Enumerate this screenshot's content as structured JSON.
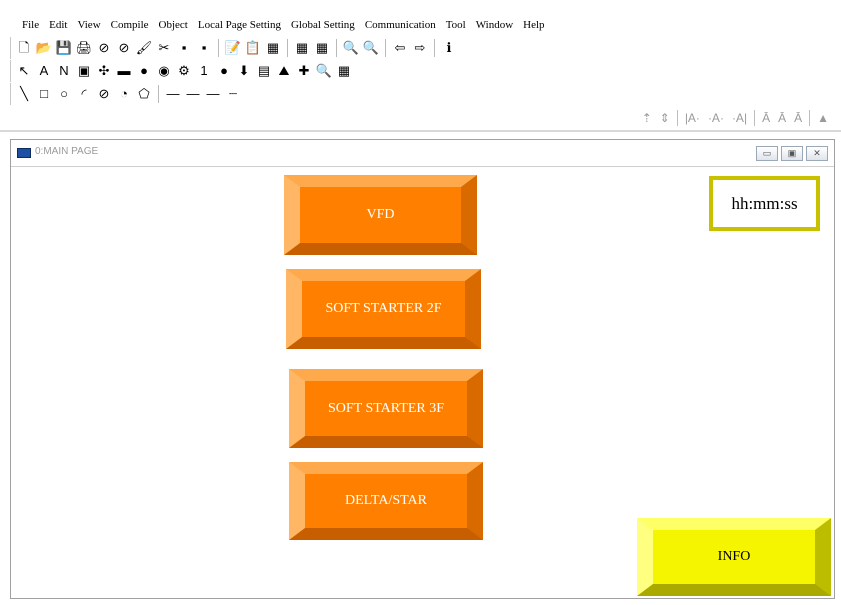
{
  "menu": [
    "File",
    "Edit",
    "View",
    "Compile",
    "Object",
    "Local Page Setting",
    "Global Setting",
    "Communication",
    "Tool",
    "Window",
    "Help"
  ],
  "toolbar1": [
    "🗋",
    "📂",
    "💾",
    "🖨",
    "⊘",
    "⊘",
    "🖌",
    "✂",
    "▪",
    "▪",
    "📝",
    "📋",
    "▦",
    "▦",
    "▦",
    "🔍",
    "🔍",
    "⇦",
    "⇨",
    "ℹ"
  ],
  "toolbar2": [
    "↖",
    "A",
    "N",
    "▣",
    "✣",
    "▬",
    "●",
    "◉",
    "⚙",
    "1",
    "●",
    "⬇",
    "▤",
    "⛰",
    "✚",
    "🔍",
    "▦"
  ],
  "toolbar3": [
    "╲",
    "□",
    "○",
    "◜",
    "⊘",
    "◔",
    "⬠",
    "—",
    "—",
    "—",
    "┈"
  ],
  "right_tools": [
    "⇡",
    "⇕",
    "|A·",
    "·A·",
    "·A|",
    "Ā",
    "Ā",
    "Ā",
    "▲"
  ],
  "page_window": {
    "title": "0:MAIN PAGE"
  },
  "buttons": {
    "vfd": "VFD",
    "soft2": "SOFT STARTER 2F",
    "soft3": "SOFT STARTER 3F",
    "delta": "DELTA/STAR",
    "info": "INFO"
  },
  "clock_text": "hh:mm:ss",
  "colors": {
    "orange": "#FF8000",
    "yellow": "#F5F500",
    "clock_border": "#C8C100"
  }
}
